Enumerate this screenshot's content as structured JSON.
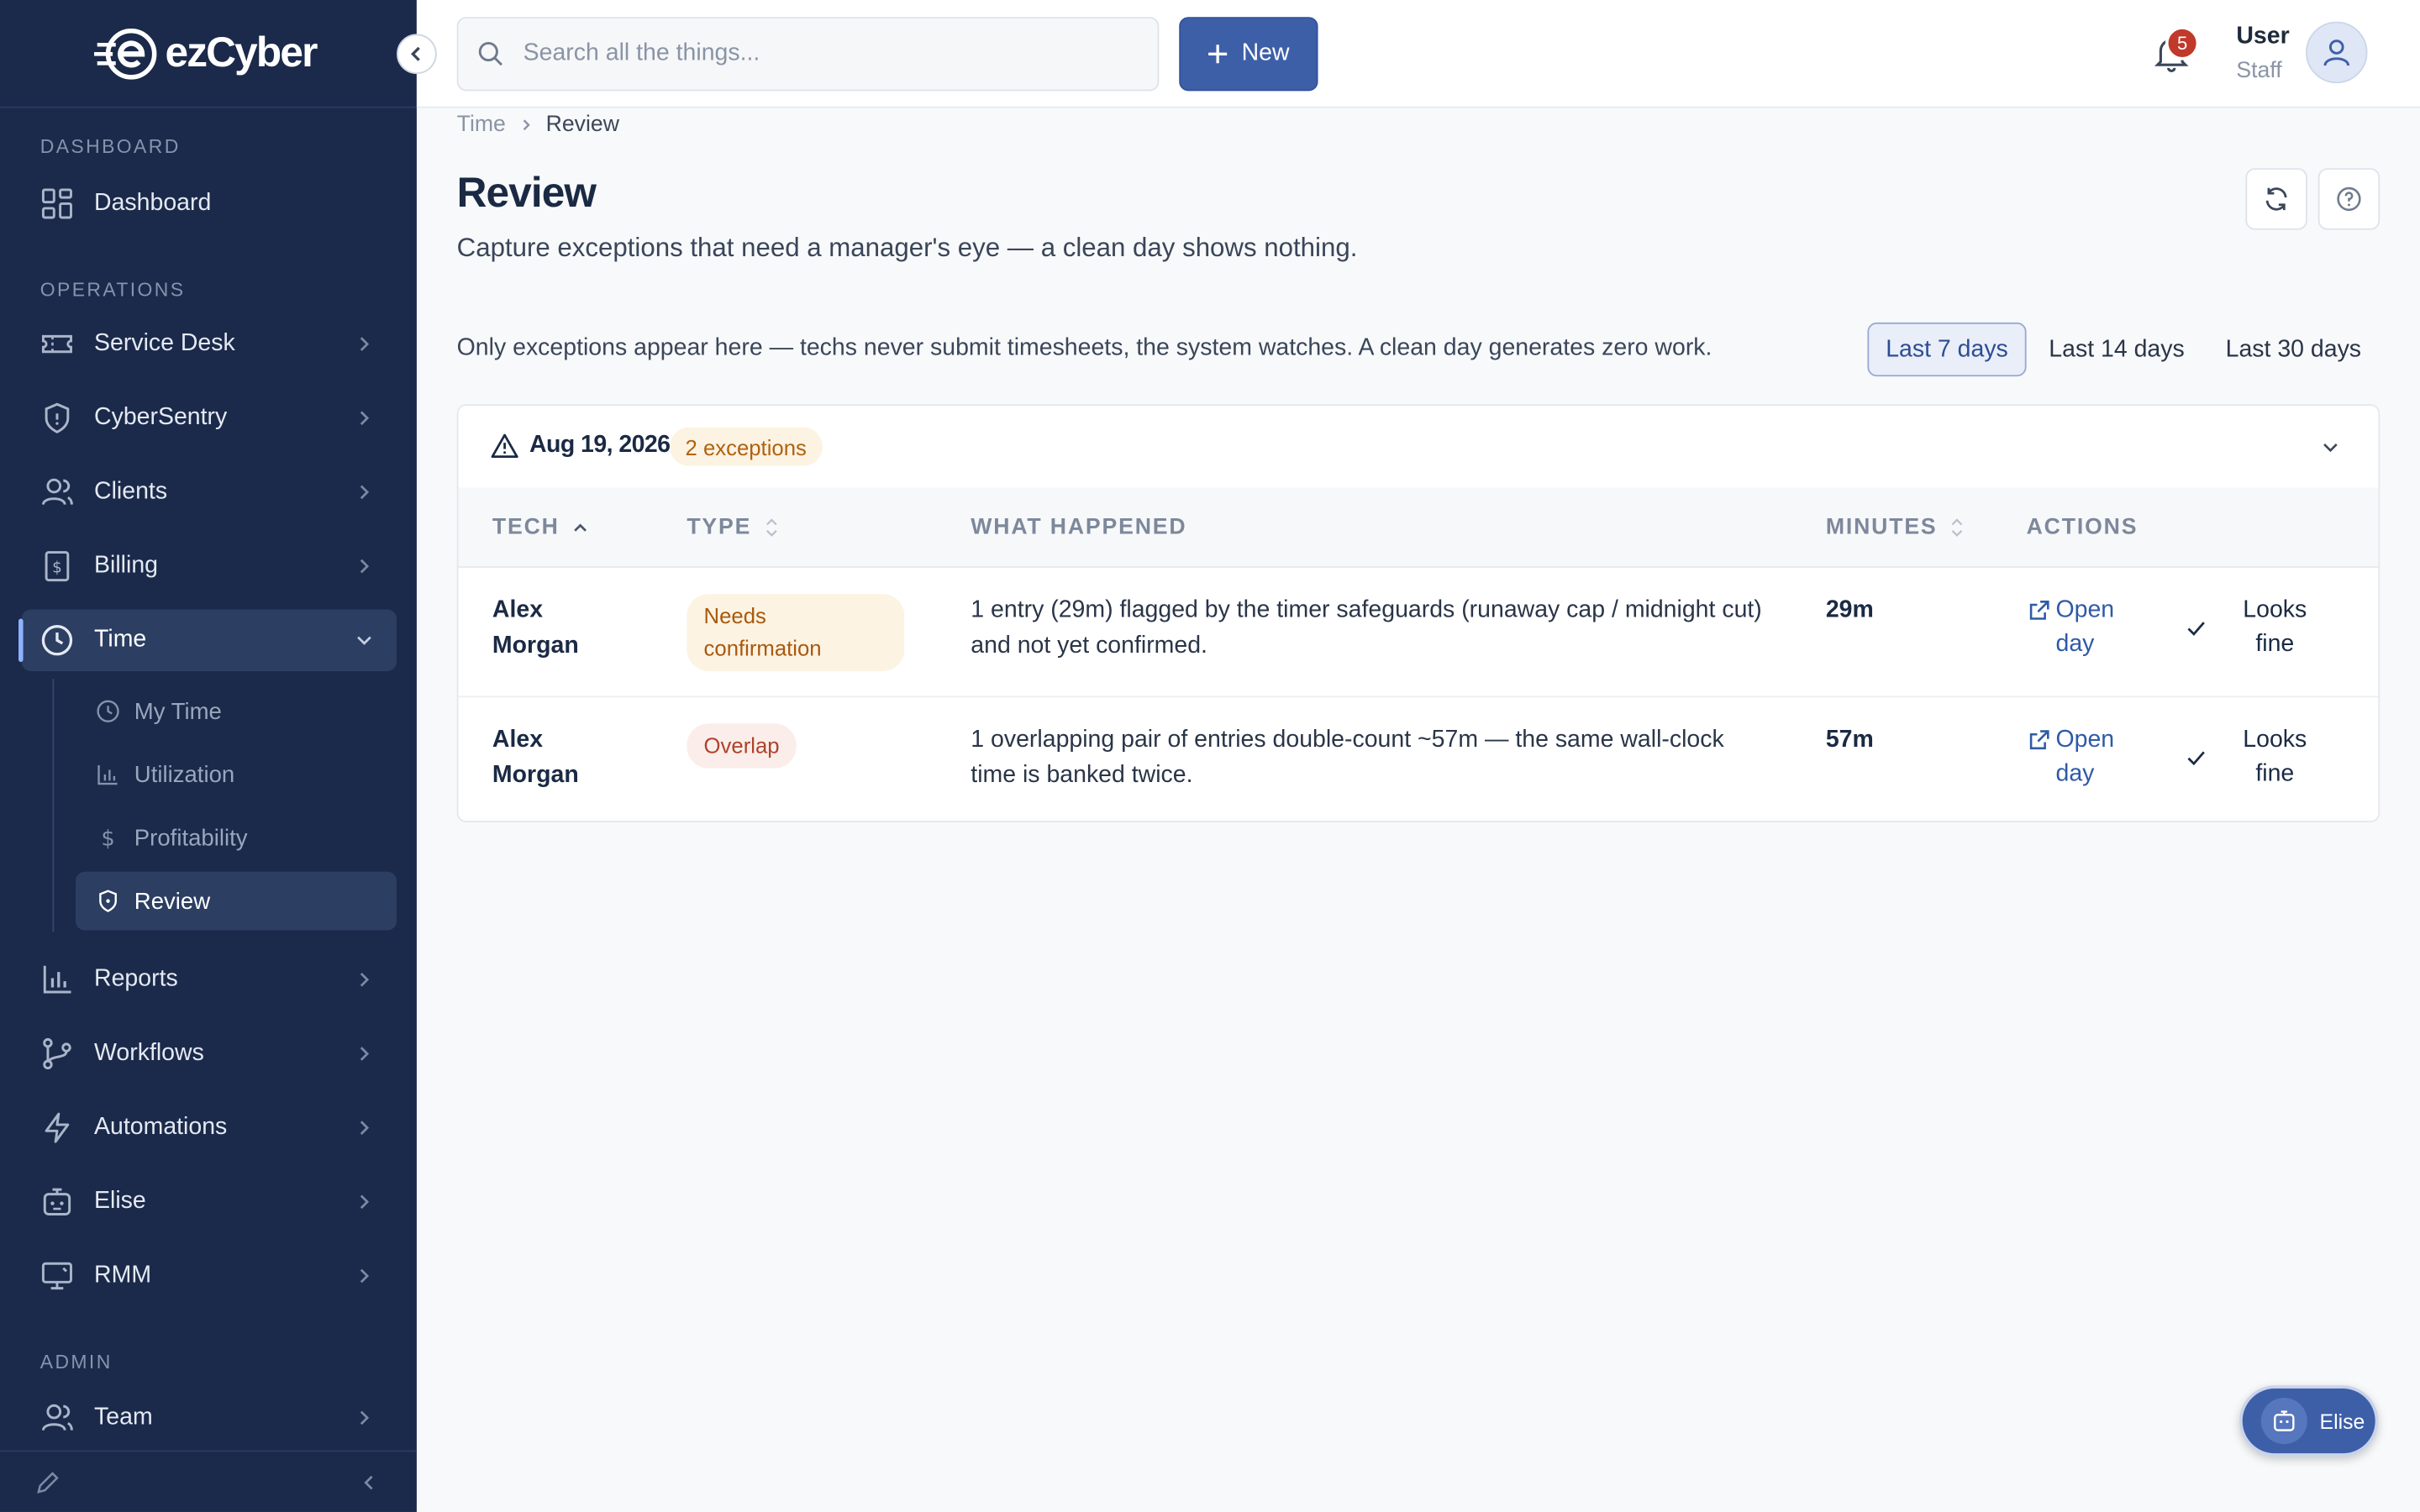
{
  "brand": {
    "name": "ezCyber"
  },
  "sidebar": {
    "sections": {
      "dashboard": "DASHBOARD",
      "operations": "OPERATIONS",
      "admin": "ADMIN"
    },
    "items": [
      {
        "label": "Dashboard",
        "icon": "dashboard-icon"
      },
      {
        "label": "Service Desk",
        "icon": "ticket-icon"
      },
      {
        "label": "CyberSentry",
        "icon": "shield-icon"
      },
      {
        "label": "Clients",
        "icon": "users-icon"
      },
      {
        "label": "Billing",
        "icon": "receipt-icon"
      },
      {
        "label": "Time",
        "icon": "clock-icon",
        "expanded": true
      },
      {
        "label": "Reports",
        "icon": "bar-chart-icon"
      },
      {
        "label": "Workflows",
        "icon": "branch-icon"
      },
      {
        "label": "Automations",
        "icon": "bolt-icon"
      },
      {
        "label": "Elise",
        "icon": "bot-icon"
      },
      {
        "label": "RMM",
        "icon": "monitor-icon"
      },
      {
        "label": "Team",
        "icon": "team-icon"
      }
    ],
    "time_sub": [
      {
        "label": "My Time",
        "icon": "clock-icon"
      },
      {
        "label": "Utilization",
        "icon": "bar-chart-icon"
      },
      {
        "label": "Profitability",
        "icon": "dollar-icon"
      },
      {
        "label": "Review",
        "icon": "shield-icon",
        "active": true
      }
    ]
  },
  "topbar": {
    "search_placeholder": "Search all the things...",
    "new_label": "New",
    "notification_count": "5",
    "user_name": "User",
    "user_role": "Staff"
  },
  "page": {
    "breadcrumb": [
      "Time",
      "Review"
    ],
    "title": "Review",
    "subtitle": "Capture exceptions that need a manager's eye — a clean day shows nothing.",
    "info": "Only exceptions appear here — techs never submit timesheets, the system watches. A clean day generates zero work.",
    "ranges": [
      "Last 7 days",
      "Last 14 days",
      "Last 30 days"
    ],
    "selected_range": "Last 7 days"
  },
  "group": {
    "date": "Aug 19, 2026",
    "badge": "2 exceptions",
    "columns": {
      "tech": "TECH",
      "type": "TYPE",
      "what": "WHAT HAPPENED",
      "minutes": "MINUTES",
      "actions": "ACTIONS"
    },
    "rows": [
      {
        "tech_first": "Alex",
        "tech_last": "Morgan",
        "type_line1": "Needs",
        "type_line2": "confirmation",
        "what_line1": "1 entry (29m) flagged by the timer safeguards (runaway cap / midnight cut)",
        "what_line2": "and not yet confirmed.",
        "minutes": "29m",
        "open1": "Open",
        "open2": "day",
        "fine1": "Looks",
        "fine2": "fine"
      },
      {
        "tech_first": "Alex",
        "tech_last": "Morgan",
        "type_line1": "Overlap",
        "what_line1": "1 overlapping pair of entries double-count ~57m — the same wall-clock",
        "what_line2": "time is banked twice.",
        "minutes": "57m",
        "open1": "Open",
        "open2": "day",
        "fine1": "Looks",
        "fine2": "fine"
      }
    ]
  },
  "fab": {
    "label": "Elise"
  },
  "colors": {
    "sidebar_bg": "#1b2a4a",
    "accent": "#3d5fa8",
    "warn": "#a9590d",
    "danger": "#b0422c"
  }
}
